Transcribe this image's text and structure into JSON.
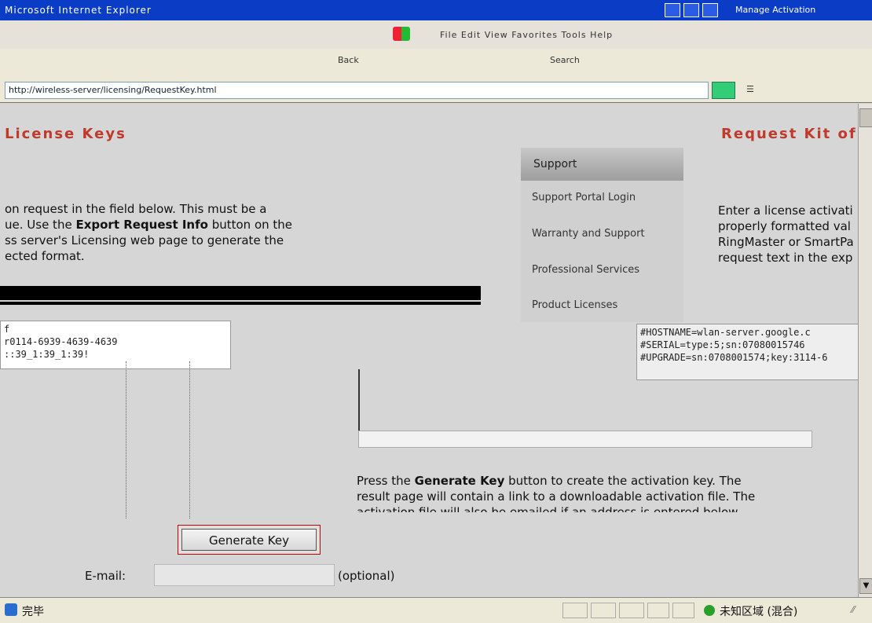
{
  "window": {
    "title": "Microsoft Internet Explorer",
    "right_title": "Manage Activation"
  },
  "menubar": {
    "text": "File Edit View Favorites Tools Help"
  },
  "toolbar": {
    "back_label": "Back",
    "search_label": "Search"
  },
  "address": {
    "url": "http://wireless-server/licensing/RequestKey.html"
  },
  "page": {
    "heading_left": "License Keys",
    "heading_right": "Request Kit of",
    "left_para": [
      "on request in the field below. This must be a",
      "ue. Use the ",
      "ss server's Licensing web page to generate the",
      "ected format."
    ],
    "left_bold": "Export Request Info",
    "left_bold_after": " button on the",
    "left_textarea_lines": [
      "f",
      "r0114-6939-4639-4639",
      "::39_1:39_1:39!"
    ],
    "right_para": [
      "Enter a license activati",
      "properly formatted val",
      "RingMaster or SmartPa",
      "request text in the exp"
    ],
    "right_textarea_lines": [
      "#HOSTNAME=wlan-server.google.c",
      "#SERIAL=type:5;sn:07080015746",
      "#UPGRADE=sn:0708001574;key:3114-6"
    ],
    "generate_para": [
      "Press the ",
      " button to create the activation key. The",
      "result page will contain a link to a downloadable activation file. The",
      "activation file will also be emailed if an address is entered below."
    ],
    "generate_bold": "Generate Key",
    "generate_button": "Generate Key",
    "email_label": "E-mail:",
    "email_value": "",
    "optional_label": "(optional)"
  },
  "support_menu": {
    "header": "Support",
    "items": [
      "Support Portal Login",
      "Warranty and Support",
      "Professional Services",
      "Product Licenses"
    ]
  },
  "status": {
    "left_text": "完毕",
    "zone_text": "未知区域 (混合)"
  }
}
